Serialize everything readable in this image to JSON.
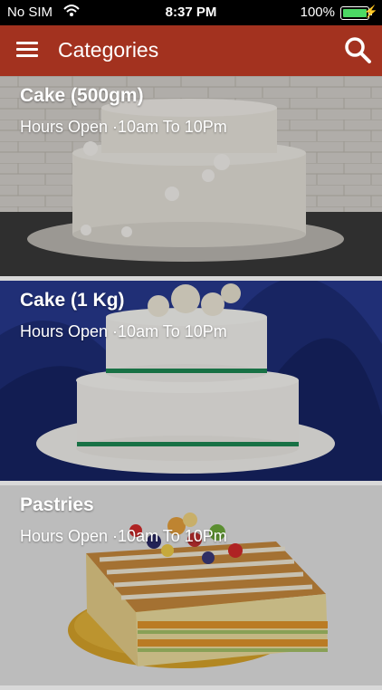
{
  "status_bar": {
    "carrier": "No SIM",
    "time": "8:37 PM",
    "battery_percent": "100%",
    "wifi_icon": "wifi-icon",
    "battery_icon": "battery-icon",
    "charging_icon": "bolt-icon",
    "battery_color": "#4cd964"
  },
  "navbar": {
    "title": "Categories",
    "menu_icon": "hamburger-menu-icon",
    "search_icon": "search-icon",
    "background": "#a3321f"
  },
  "categories": [
    {
      "title": "Cake (500gm)",
      "hours": "Hours Open ·10am To 10Pm"
    },
    {
      "title": "Cake (1 Kg)",
      "hours": "Hours Open ·10am To 10Pm"
    },
    {
      "title": "Pastries",
      "hours": "Hours Open ·10am To 10Pm"
    }
  ]
}
